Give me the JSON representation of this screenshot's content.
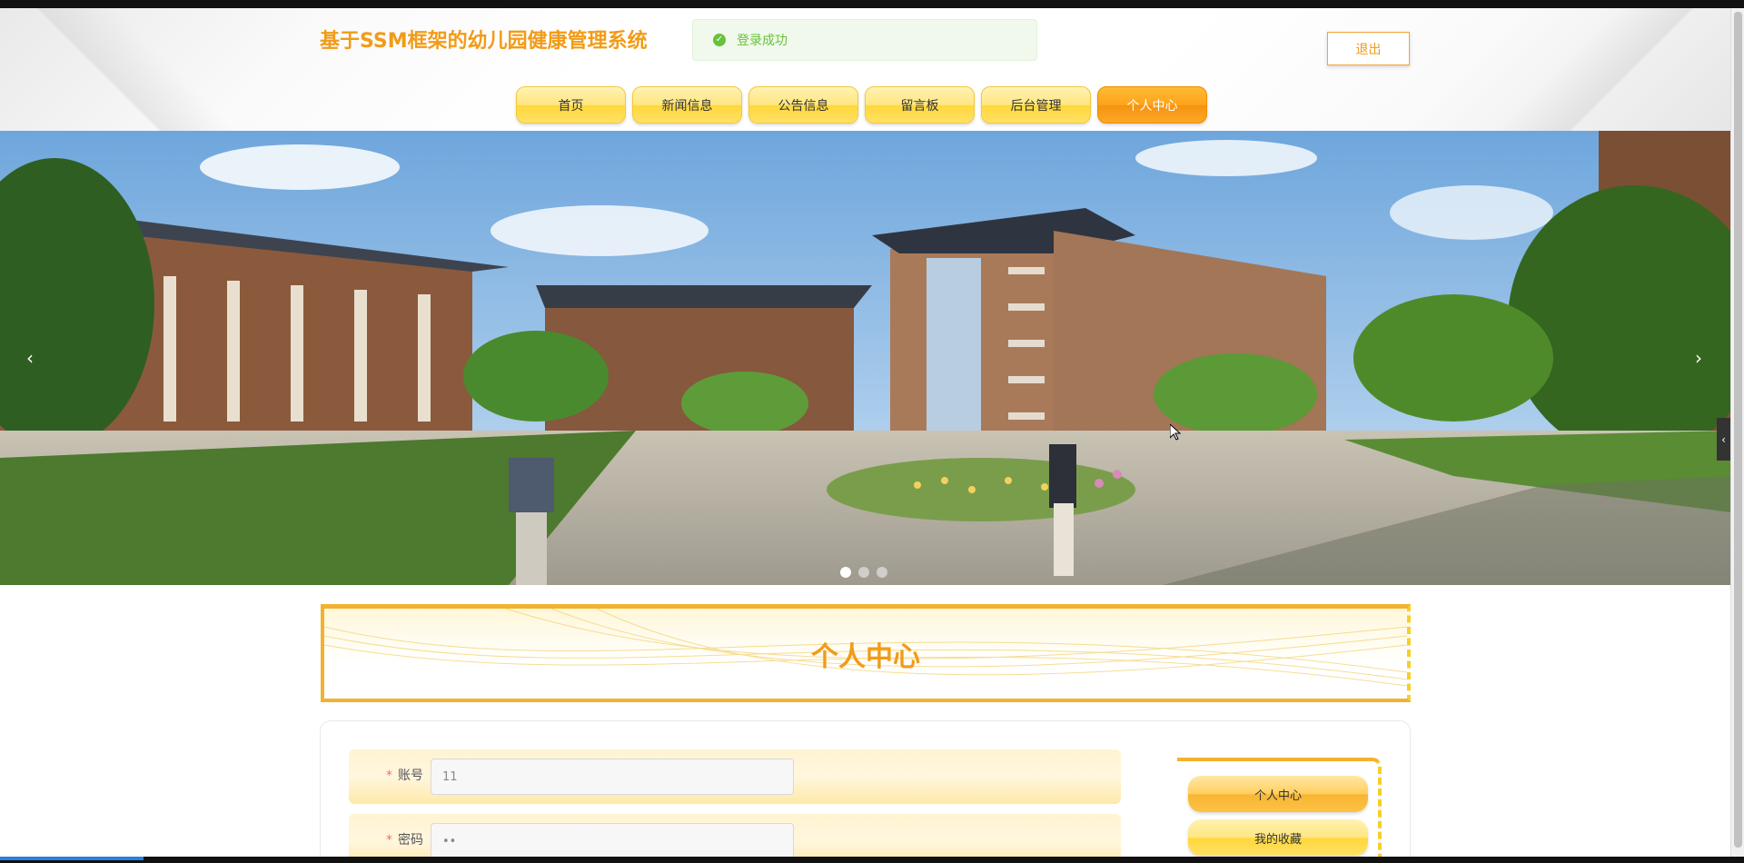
{
  "header": {
    "site_title": "基于SSM框架的幼儿园健康管理系统",
    "toast_message": "登录成功",
    "logout_label": "退出"
  },
  "nav": {
    "items": [
      {
        "label": "首页"
      },
      {
        "label": "新闻信息"
      },
      {
        "label": "公告信息"
      },
      {
        "label": "留言板"
      },
      {
        "label": "后台管理"
      },
      {
        "label": "个人中心"
      }
    ],
    "active_index": 5
  },
  "carousel": {
    "prev_glyph": "‹",
    "next_glyph": "›",
    "slide_count": 3,
    "active_slide": 0,
    "side_tab_glyph": "‹"
  },
  "section": {
    "title": "个人中心"
  },
  "form": {
    "account_label": "账号",
    "account_value": "11",
    "password_label": "密码",
    "password_value": "••",
    "required_mark": "*"
  },
  "side_menu": {
    "items": [
      {
        "label": "个人中心"
      },
      {
        "label": "我的收藏"
      }
    ]
  },
  "colors": {
    "brand_orange": "#f29b17",
    "nav_yellow": "#ffe066",
    "toast_green": "#67c23a"
  }
}
